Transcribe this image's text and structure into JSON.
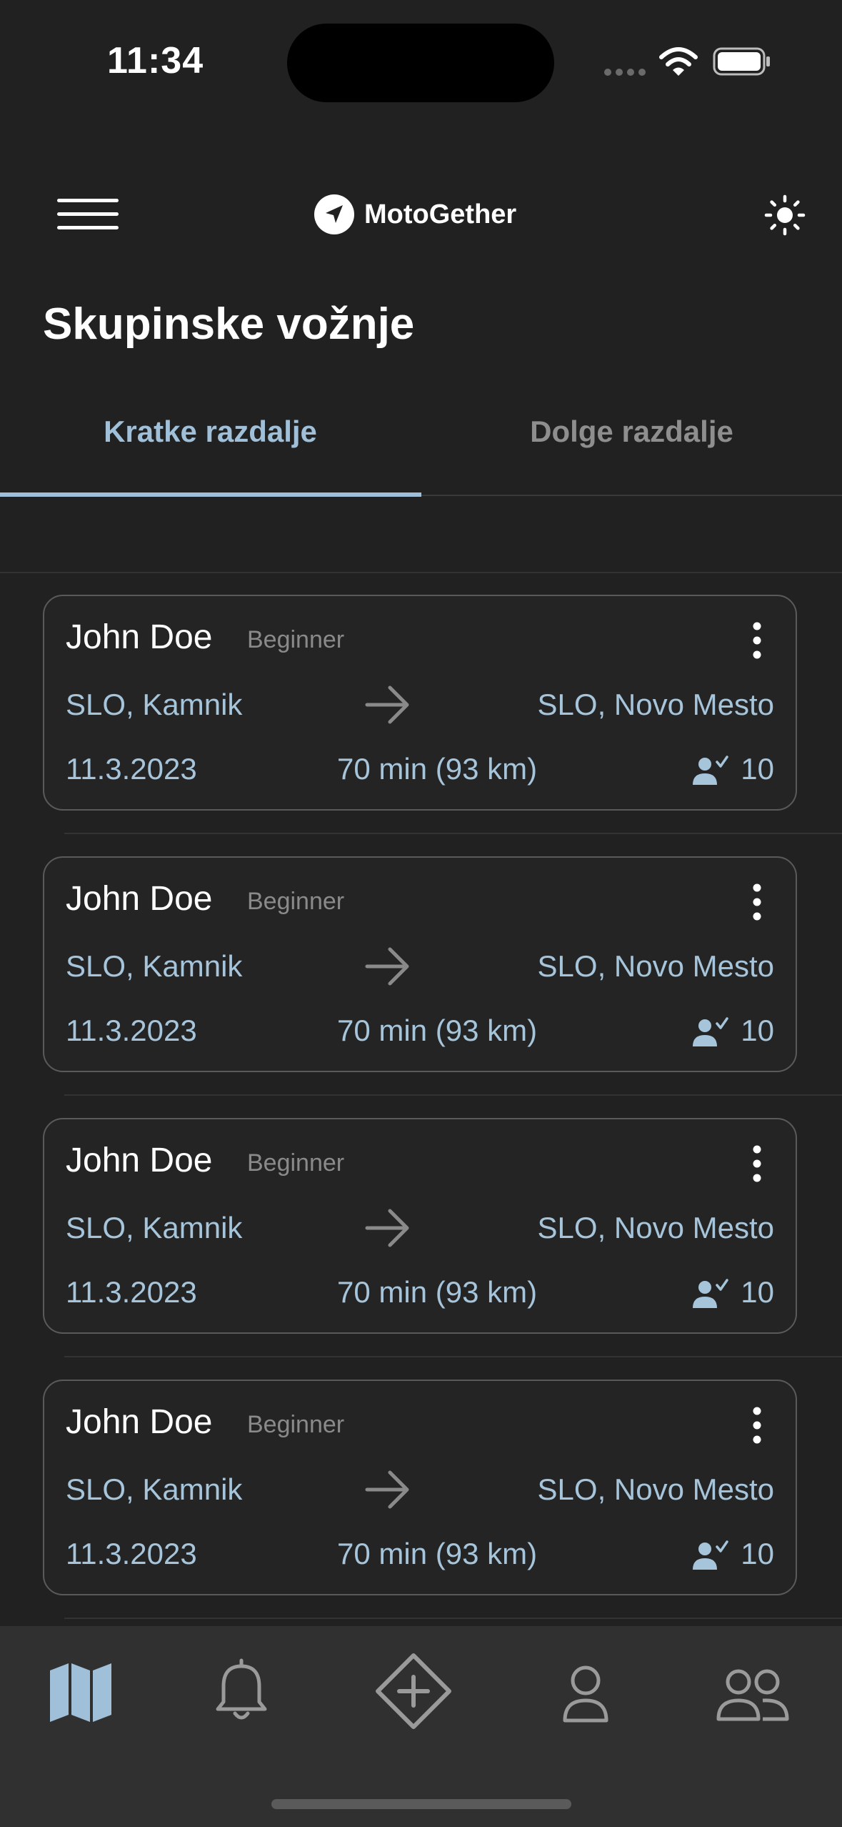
{
  "status_bar": {
    "time": "11:34"
  },
  "app_bar": {
    "brand_name": "MotoGether",
    "menu_icon": "hamburger-menu-icon",
    "logo_icon": "navigation-arrow-icon",
    "theme_icon": "sun-icon"
  },
  "page": {
    "title": "Skupinske vožnje"
  },
  "tabs": [
    {
      "label": "Kratke razdalje",
      "active": true
    },
    {
      "label": "Dolge razdalje",
      "active": false
    }
  ],
  "rides": [
    {
      "name": "John Doe",
      "level": "Beginner",
      "from": "SLO, Kamnik",
      "to": "SLO, Novo Mesto",
      "date": "11.3.2023",
      "duration": "70 min (93 km)",
      "riders": "10"
    },
    {
      "name": "John Doe",
      "level": "Beginner",
      "from": "SLO, Kamnik",
      "to": "SLO, Novo Mesto",
      "date": "11.3.2023",
      "duration": "70 min (93 km)",
      "riders": "10"
    },
    {
      "name": "John Doe",
      "level": "Beginner",
      "from": "SLO, Kamnik",
      "to": "SLO, Novo Mesto",
      "date": "11.3.2023",
      "duration": "70 min (93 km)",
      "riders": "10"
    },
    {
      "name": "John Doe",
      "level": "Beginner",
      "from": "SLO, Kamnik",
      "to": "SLO, Novo Mesto",
      "date": "11.3.2023",
      "duration": "70 min (93 km)",
      "riders": "10"
    }
  ],
  "bottom_nav": {
    "items": [
      "map-icon",
      "bell-icon",
      "add-ride-icon",
      "profile-icon",
      "group-icon"
    ],
    "active": "map-icon"
  },
  "colors": {
    "background": "#212121",
    "accent": "#9fc0d8",
    "card_text": "#a6c4da",
    "muted": "#8e8e8e",
    "nav_background": "#303030"
  }
}
